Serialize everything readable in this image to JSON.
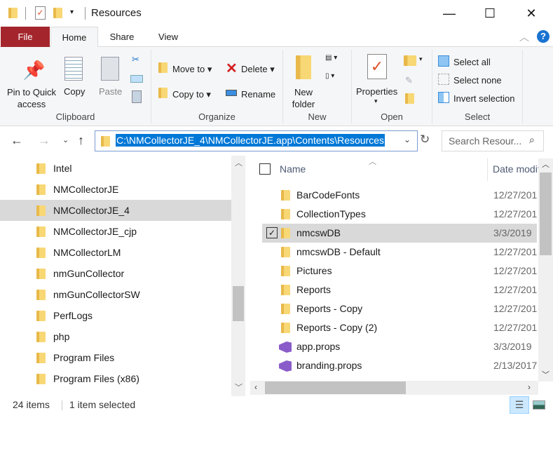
{
  "window": {
    "title": "Resources",
    "minimize": "—",
    "maximize": "☐",
    "close": "✕"
  },
  "ribbon_tabs": {
    "file": "File",
    "home": "Home",
    "share": "Share",
    "view": "View"
  },
  "ribbon": {
    "clipboard": {
      "label": "Clipboard",
      "pin": "Pin to Quick access",
      "copy": "Copy",
      "paste": "Paste"
    },
    "organize": {
      "label": "Organize",
      "move_to": "Move to",
      "copy_to": "Copy to",
      "delete": "Delete",
      "rename": "Rename"
    },
    "new": {
      "label": "New",
      "new_folder": "New folder"
    },
    "open": {
      "label": "Open",
      "properties": "Properties"
    },
    "select": {
      "label": "Select",
      "select_all": "Select all",
      "select_none": "Select none",
      "invert": "Invert selection"
    }
  },
  "address": {
    "path": "C:\\NMCollectorJE_4\\NMCollectorJE.app\\Contents\\Resources",
    "search_placeholder": "Search Resour..."
  },
  "nav_items": [
    {
      "label": "Intel"
    },
    {
      "label": "NMCollectorJE"
    },
    {
      "label": "NMCollectorJE_4",
      "selected": true
    },
    {
      "label": "NMCollectorJE_cjp"
    },
    {
      "label": "NMCollectorLM"
    },
    {
      "label": "nmGunCollector"
    },
    {
      "label": "nmGunCollectorSW"
    },
    {
      "label": "PerfLogs"
    },
    {
      "label": "php"
    },
    {
      "label": "Program Files"
    },
    {
      "label": "Program Files (x86)"
    }
  ],
  "columns": {
    "name": "Name",
    "date": "Date modified"
  },
  "files": [
    {
      "name": "BarCodeFonts",
      "date": "12/27/201",
      "type": "folder"
    },
    {
      "name": "CollectionTypes",
      "date": "12/27/201",
      "type": "folder"
    },
    {
      "name": "nmcswDB",
      "date": "3/3/2019",
      "type": "folder",
      "selected": true
    },
    {
      "name": "nmcswDB - Default",
      "date": "12/27/201",
      "type": "folder"
    },
    {
      "name": "Pictures",
      "date": "12/27/201",
      "type": "folder"
    },
    {
      "name": "Reports",
      "date": "12/27/201",
      "type": "folder"
    },
    {
      "name": "Reports - Copy",
      "date": "12/27/201",
      "type": "folder"
    },
    {
      "name": "Reports - Copy (2)",
      "date": "12/27/201",
      "type": "folder"
    },
    {
      "name": "app.props",
      "date": "3/3/2019",
      "type": "vs"
    },
    {
      "name": "branding.props",
      "date": "2/13/2017",
      "type": "vs"
    }
  ],
  "status": {
    "count": "24 items",
    "selected": "1 item selected"
  },
  "colors": {
    "file_tab": "#a4262c",
    "accent": "#0078d7",
    "selection": "#d9d9d9"
  }
}
